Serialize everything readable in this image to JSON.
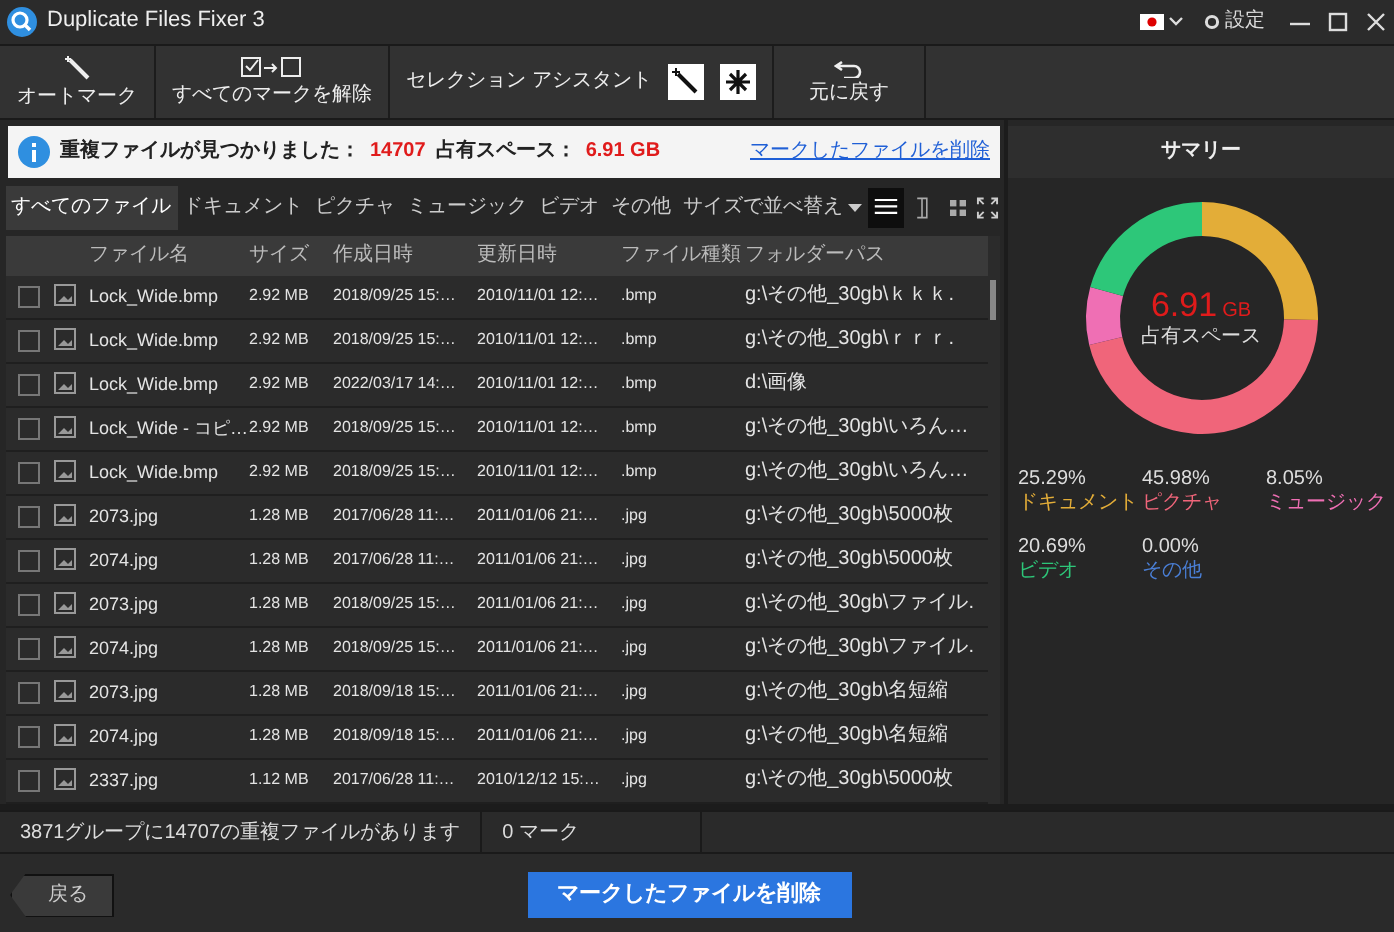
{
  "window": {
    "title": "Duplicate Files Fixer 3",
    "settings": "設定"
  },
  "toolbar": [
    {
      "kind": "automark",
      "label": "オートマーク"
    },
    {
      "kind": "unmark",
      "label": "すべてのマークを解除"
    },
    {
      "kind": "assistant",
      "label": "セレクション アシスタント"
    },
    {
      "kind": "undo",
      "label": "元に戻す"
    }
  ],
  "info_bar": {
    "found_label": "重複ファイルが見つかりました：",
    "found_count": "14707",
    "space_label": "占有スペース：",
    "space_value": "6.91 GB",
    "link": "マークしたファイルを削除"
  },
  "tabs": [
    {
      "label": "すべてのファイル",
      "selected": true
    },
    {
      "label": "ドキュメント",
      "selected": false
    },
    {
      "label": "ピクチャ",
      "selected": false
    },
    {
      "label": "ミュージック",
      "selected": false
    },
    {
      "label": "ビデオ",
      "selected": false
    },
    {
      "label": "その他",
      "selected": false
    }
  ],
  "sort": "サイズで並べ替え",
  "views": [
    {
      "kind": "list",
      "selected": true
    },
    {
      "kind": "columns",
      "selected": false
    },
    {
      "kind": "grid",
      "selected": false
    }
  ],
  "table": {
    "columns": [
      "ファイル名",
      "サイズ",
      "作成日時",
      "更新日時",
      "ファイル種類",
      "フォルダーパス"
    ],
    "rows": [
      {
        "checked": false,
        "cells": [
          "Lock_Wide.bmp",
          "2.92 MB",
          "2018/09/25 15:…",
          "2010/11/01 12:…",
          ".bmp",
          "g:\\その他_30gb\\ｋｋｋ."
        ]
      },
      {
        "checked": false,
        "cells": [
          "Lock_Wide.bmp",
          "2.92 MB",
          "2018/09/25 15:…",
          "2010/11/01 12:…",
          ".bmp",
          "g:\\その他_30gb\\ｒｒｒ."
        ]
      },
      {
        "checked": false,
        "cells": [
          "Lock_Wide.bmp",
          "2.92 MB",
          "2022/03/17 14:…",
          "2010/11/01 12:…",
          ".bmp",
          "d:\\画像"
        ]
      },
      {
        "checked": false,
        "cells": [
          "Lock_Wide - コピ…",
          "2.92 MB",
          "2018/09/25 15:…",
          "2010/11/01 12:…",
          ".bmp",
          "g:\\その他_30gb\\いろん…"
        ]
      },
      {
        "checked": false,
        "cells": [
          "Lock_Wide.bmp",
          "2.92 MB",
          "2018/09/25 15:…",
          "2010/11/01 12:…",
          ".bmp",
          "g:\\その他_30gb\\いろん…"
        ]
      },
      {
        "checked": false,
        "cells": [
          "2073.jpg",
          "1.28 MB",
          "2017/06/28 11:…",
          "2011/01/06 21:…",
          ".jpg",
          "g:\\その他_30gb\\5000枚"
        ]
      },
      {
        "checked": false,
        "cells": [
          "2074.jpg",
          "1.28 MB",
          "2017/06/28 11:…",
          "2011/01/06 21:…",
          ".jpg",
          "g:\\その他_30gb\\5000枚"
        ]
      },
      {
        "checked": false,
        "cells": [
          "2073.jpg",
          "1.28 MB",
          "2018/09/25 15:…",
          "2011/01/06 21:…",
          ".jpg",
          "g:\\その他_30gb\\ファイル."
        ]
      },
      {
        "checked": false,
        "cells": [
          "2074.jpg",
          "1.28 MB",
          "2018/09/25 15:…",
          "2011/01/06 21:…",
          ".jpg",
          "g:\\その他_30gb\\ファイル."
        ]
      },
      {
        "checked": false,
        "cells": [
          "2073.jpg",
          "1.28 MB",
          "2018/09/18 15:…",
          "2011/01/06 21:…",
          ".jpg",
          "g:\\その他_30gb\\名短縮"
        ]
      },
      {
        "checked": false,
        "cells": [
          "2074.jpg",
          "1.28 MB",
          "2018/09/18 15:…",
          "2011/01/06 21:…",
          ".jpg",
          "g:\\その他_30gb\\名短縮"
        ]
      },
      {
        "checked": false,
        "cells": [
          "2337.jpg",
          "1.12 MB",
          "2017/06/28 11:…",
          "2010/12/12 15:…",
          ".jpg",
          "g:\\その他_30gb\\5000枚"
        ]
      }
    ]
  },
  "summary": {
    "title": "サマリー",
    "total_value": "6.91",
    "total_unit": "GB",
    "total_label": "占有スペース",
    "chart_data": {
      "type": "donut",
      "values": [
        25.29,
        45.98,
        8.05,
        20.69,
        0.0
      ]
    },
    "legend": [
      {
        "percent": "25.29%",
        "label": "ドキュメント",
        "color": "#e3ad38"
      },
      {
        "percent": "45.98%",
        "label": "ピクチャ",
        "color": "#f0657a"
      },
      {
        "percent": "8.05%",
        "label": "ミュージック",
        "color": "#ef6fb4"
      },
      {
        "percent": "20.69%",
        "label": "ビデオ",
        "color": "#2dc779"
      },
      {
        "percent": "0.00%",
        "label": "その他",
        "color": "#4a7fd6"
      }
    ]
  },
  "status_bar": [
    "3871グループに14707の重複ファイルがあります",
    "0 マーク"
  ],
  "footer": {
    "back": "戻る",
    "delete": "マークしたファイルを削除"
  }
}
